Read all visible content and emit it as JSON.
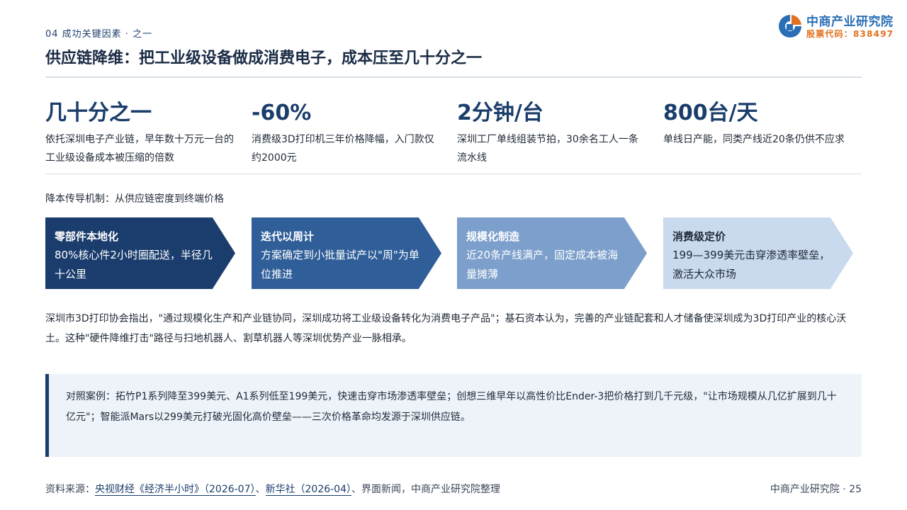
{
  "header": {
    "section_tag": "04 成功关键因素 · 之一",
    "title": "供应链降维：把工业级设备做成消费电子，成本压至几十分之一"
  },
  "logo": {
    "name": "中商产业研究院",
    "code": "股票代码：838497"
  },
  "stats": [
    {
      "value": "几十分之一",
      "desc": "依托深圳电子产业链，早年数十万元一台的工业级设备成本被压缩的倍数"
    },
    {
      "value": "-60%",
      "desc": "消费级3D打印机三年价格降幅，入门款仅约2000元"
    },
    {
      "value": "2分钟/台",
      "desc": "深圳工厂单线组装节拍，30余名工人一条流水线"
    },
    {
      "value": "800台/天",
      "desc": "单线日产能，同类产线近20条仍供不应求"
    }
  ],
  "flow": {
    "heading": "降本传导机制：从供应链密度到终端价格",
    "steps": [
      {
        "title": "零部件本地化",
        "desc": "80%核心件2小时圈配送，半径几十公里"
      },
      {
        "title": "迭代以周计",
        "desc": "方案确定到小批量试产以\"周\"为单位推进"
      },
      {
        "title": "规模化制造",
        "desc": "近20条产线满产，固定成本被海量摊薄"
      },
      {
        "title": "消费级定价",
        "desc": "199—399美元击穿渗透率壁垒，激活大众市场"
      }
    ]
  },
  "paragraph": "深圳市3D打印协会指出，\"通过规模化生产和产业链协同，深圳成功将工业级设备转化为消费电子产品\"；基石资本认为，完善的产业链配套和人才储备使深圳成为3D打印产业的核心沃土。这种\"硬件降维打击\"路径与扫地机器人、割草机器人等深圳优势产业一脉相承。",
  "callout": "对照案例：拓竹P1系列降至399美元、A1系列低至199美元，快速击穿市场渗透率壁垒；创想三维早年以高性价比Ender-3把价格打到几千元级，\"让市场规模从几亿扩展到几十亿元\"；智能派Mars以299美元打破光固化高价壁垒——三次价格革命均发源于深圳供应链。",
  "footer": {
    "source_prefix": "资料来源：",
    "source_1": "央视财经《经济半小时》（2026-07）",
    "sep": "、",
    "source_2": "新华社（2026-04）",
    "source_rest": "、界面新闻，中商产业研究院整理",
    "page": "中商产业研究院 · 25"
  },
  "colors": {
    "primary": "#1b3d6e",
    "step_2": "#2f5e99",
    "step_3": "#7c9fcb",
    "step_4": "#c9d9ee",
    "logo_blue": "#2a6fb6",
    "logo_orange": "#e3701f"
  }
}
